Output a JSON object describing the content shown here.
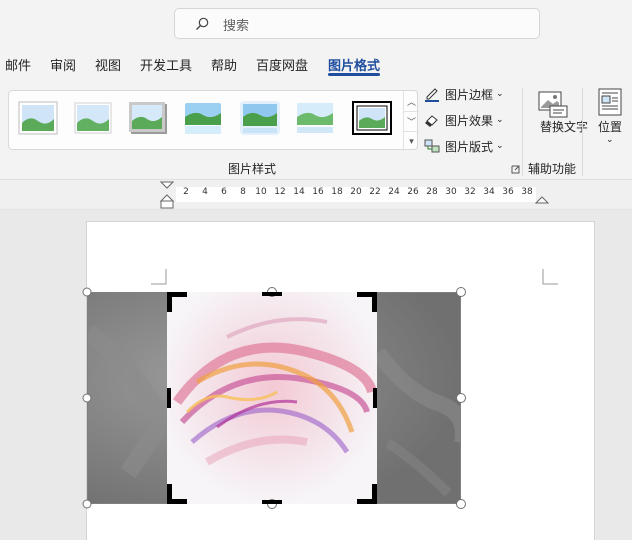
{
  "search": {
    "placeholder": "搜索"
  },
  "tabs": [
    {
      "label": "邮件"
    },
    {
      "label": "审阅"
    },
    {
      "label": "视图"
    },
    {
      "label": "开发工具"
    },
    {
      "label": "帮助"
    },
    {
      "label": "百度网盘"
    },
    {
      "label": "图片格式",
      "active": true
    }
  ],
  "ribbon": {
    "picture_styles": {
      "label": "图片样式",
      "styles": [
        "simple-frame-white",
        "soft-edge-rectangle",
        "drop-shadow-rectangle",
        "reflected-rounded-rectangle",
        "soft-glow",
        "reflected-bevel",
        "double-frame-black"
      ]
    },
    "commands": [
      {
        "label": "图片边框",
        "icon": "pen-border-icon"
      },
      {
        "label": "图片效果",
        "icon": "effects-icon"
      },
      {
        "label": "图片版式",
        "icon": "layout-icon"
      }
    ],
    "accessibility": {
      "label": "辅助功能",
      "alt_text_label": "替换文字"
    },
    "arrange": {
      "position_label": "位置"
    }
  },
  "ruler": {
    "ticks": [
      "2",
      "4",
      "6",
      "8",
      "10",
      "12",
      "14",
      "16",
      "18",
      "20",
      "22",
      "24",
      "26",
      "28",
      "30",
      "32",
      "34",
      "36",
      "38"
    ]
  },
  "colors": {
    "accent": "#1f4e9e",
    "ribbon_bg": "#f3f3f3",
    "crop_dim": "#707070"
  }
}
